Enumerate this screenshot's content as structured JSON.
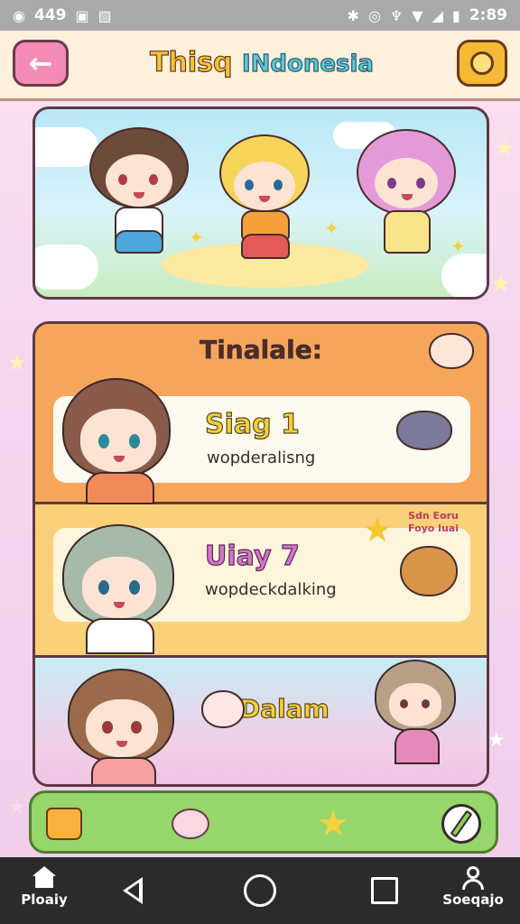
{
  "status_bar": {
    "left_text": "449",
    "time": "2:89",
    "icons": [
      "notification-icon",
      "photo-icon",
      "bluetooth-icon",
      "alarm-icon",
      "location-icon",
      "wifi-icon",
      "signal-icon",
      "battery-icon"
    ]
  },
  "header": {
    "title_part1": "Thisq",
    "title_part2": "INdonesia",
    "back_icon": "arrow-left-icon",
    "coin_icon": "coin-icon"
  },
  "panel": {
    "title": "Tinalale:",
    "slots": [
      {
        "title": "Siag 1",
        "subtitle": "wopderalisng"
      },
      {
        "title": "Uiay 7",
        "subtitle": "wopdeckdalking",
        "badge": "Sdn Eoru Foyo luai"
      },
      {
        "title": "Dalam"
      }
    ]
  },
  "actions": [
    "folder-icon",
    "pig-icon",
    "star-icon",
    "pencil-icon"
  ],
  "nav": {
    "home_label": "Ploaiy",
    "profile_label": "Soeqajo"
  },
  "colors": {
    "header_bg": "#fdf0dc",
    "back_button": "#f48ab6",
    "coin_button": "#f5b934",
    "panel_header": "#f6a65a",
    "slot_2_bg": "#fbd07a",
    "action_bar": "#95d76a",
    "nav_bar": "#2b2b2b"
  }
}
